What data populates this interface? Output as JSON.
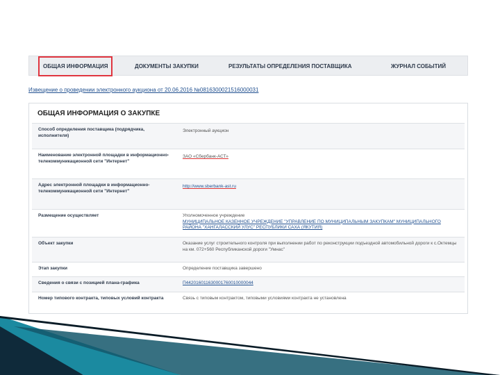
{
  "tabs": [
    {
      "label": "ОБЩАЯ ИНФОРМАЦИЯ",
      "active": true
    },
    {
      "label": "ДОКУМЕНТЫ ЗАКУПКИ",
      "active": false
    },
    {
      "label": "РЕЗУЛЬТАТЫ ОПРЕДЕЛЕНИЯ ПОСТАВЩИКА",
      "active": false
    },
    {
      "label": "ЖУРНАЛ СОБЫТИЙ",
      "active": false
    }
  ],
  "notice_link": "Извещение о проведении электронного аукциона от 20.06.2016 №0816300021516000031",
  "section_title": "ОБЩАЯ ИНФОРМАЦИЯ О ЗАКУПКЕ",
  "rows": [
    {
      "label": "Способ определения поставщика (подрядчика, исполнителя)",
      "value": "Электронный аукцион"
    },
    {
      "label": "Наименование электронной площадки в информационно-телекоммуникационной сети \"Интернет\"",
      "value": "ЗАО «Сбербанк-АСТ»"
    },
    {
      "label": "Адрес электронной площадки в информационно-телекоммуникационной сети \"Интернет\"",
      "value": "http://www.sberbank-ast.ru"
    },
    {
      "label": "Размещение осуществляет",
      "value_prefix": "Уполномоченное учреждение",
      "value": "МУНИЦИПАЛЬНОЕ КАЗЕННОЕ УЧРЕЖДЕНИЕ \"УПРАВЛЕНИЕ ПО МУНИЦИПАЛЬНЫМ ЗАКУПКАМ\" МУНИЦИПАЛЬНОГО РАЙОНА \"ХАНГАЛАССКИЙ УЛУС\" РЕСПУБЛИКИ САХА (ЯКУТИЯ)"
    },
    {
      "label": "Объект закупки",
      "value": "Оказание услуг строительного контроля при выполнении работ по реконструкции подъездной автомобильной дороги к с.Октемцы на км. 072+560 Республиканской дороги \"Умнас\""
    },
    {
      "label": "Этап закупки",
      "value": "Определение поставщика завершено"
    },
    {
      "label": "Сведения о связи с позицией плана-графика",
      "value": "П442016011630001760010000044"
    },
    {
      "label": "Номер типового контракта, типовых условий контракта",
      "value": "Связь с типовым контрактом, типовыми условиями контракта не установлена"
    }
  ],
  "colors": {
    "active_tab_border": "#e0353f",
    "link": "#1f4f8f",
    "accent_teal": "#1b8aa0",
    "accent_dark": "#0f2a3a"
  }
}
